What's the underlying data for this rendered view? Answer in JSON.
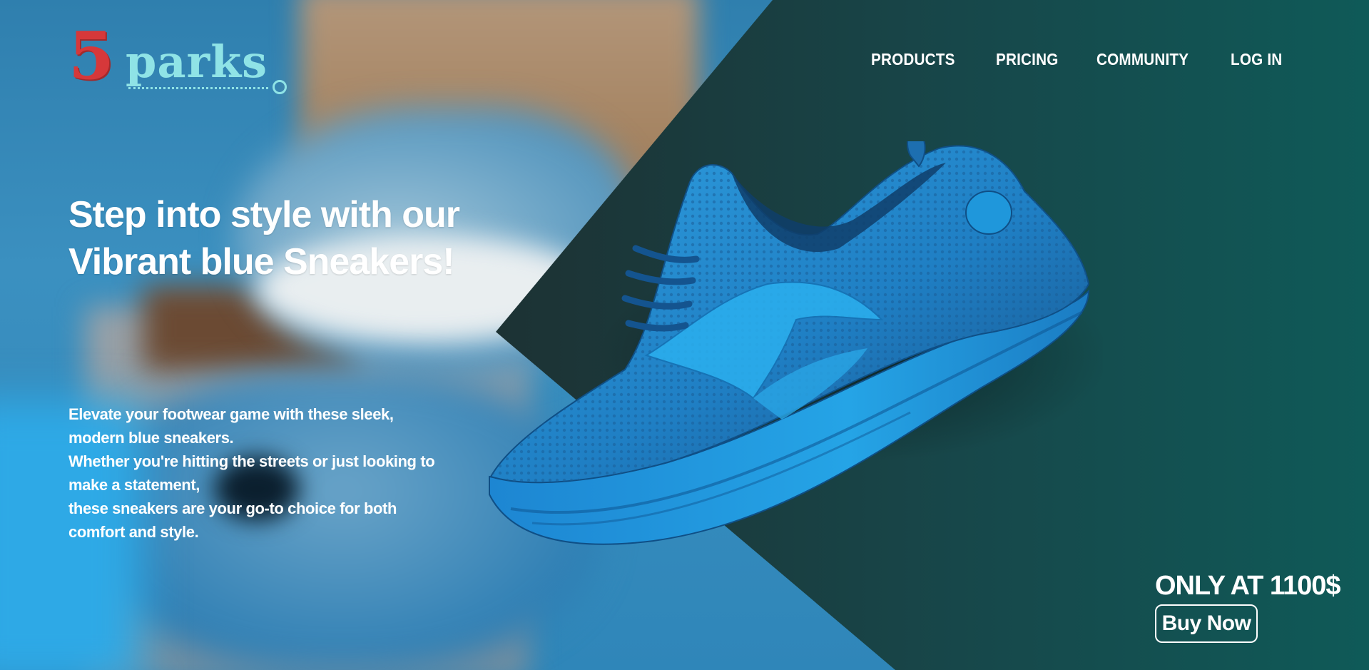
{
  "brand": {
    "logo_numeral": "5",
    "logo_text": "parks"
  },
  "nav": {
    "items": [
      {
        "label": "PRODUCTS"
      },
      {
        "label": "PRICING"
      },
      {
        "label": "COMMUNITY"
      },
      {
        "label": "LOG IN"
      }
    ]
  },
  "hero": {
    "headline_lines": [
      "Step into style with our",
      "Vibrant blue Sneakers!"
    ],
    "description_lines": [
      "Elevate your footwear game with these sleek,",
      "modern blue sneakers.",
      "Whether you're hitting the streets or just looking to",
      "make a statement,",
      "these sneakers are your go-to choice for both",
      "comfort and style."
    ],
    "price_text": "ONLY AT 1100$",
    "buy_label": "Buy Now"
  },
  "images": {
    "background": "blurred-sneakers-in-box-photo",
    "product": "blue-sneaker-product-photo"
  },
  "colors": {
    "logo_numeral": "#d6383a",
    "logo_text": "#8fe3e6",
    "panel_dark": "#1c2223",
    "panel_teal": "#0f5a58",
    "sneaker_blue": "#1e8fd6",
    "text": "#ffffff"
  }
}
